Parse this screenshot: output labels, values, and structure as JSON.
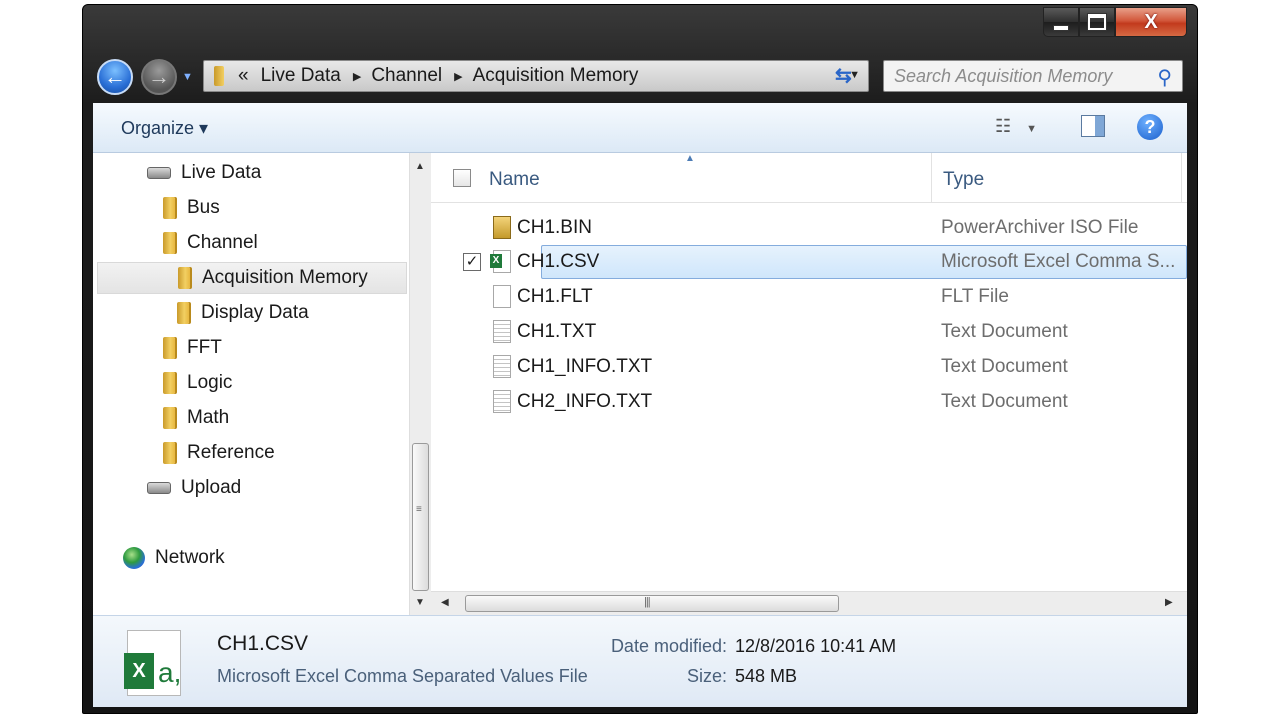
{
  "address": {
    "overflow": "«",
    "crumbs": [
      "Live Data",
      "Channel",
      "Acquisition Memory"
    ]
  },
  "search": {
    "placeholder": "Search Acquisition Memory"
  },
  "toolbar": {
    "organize_label": "Organize ▾"
  },
  "tree": [
    {
      "label": "Live Data",
      "icon": "drive-icon"
    },
    {
      "label": "Bus",
      "icon": "folder-icon"
    },
    {
      "label": "Channel",
      "icon": "folder-icon"
    },
    {
      "label": "Acquisition Memory",
      "icon": "folder-icon",
      "selected": true
    },
    {
      "label": "Display Data",
      "icon": "folder-icon"
    },
    {
      "label": "FFT",
      "icon": "folder-icon"
    },
    {
      "label": "Logic",
      "icon": "folder-icon"
    },
    {
      "label": "Math",
      "icon": "folder-icon"
    },
    {
      "label": "Reference",
      "icon": "folder-icon"
    },
    {
      "label": "Upload",
      "icon": "drive-icon"
    },
    {
      "label": "Network",
      "icon": "globe-icon"
    }
  ],
  "columns": {
    "name": "Name",
    "type": "Type"
  },
  "files": [
    {
      "name": "CH1.BIN",
      "type": "PowerArchiver ISO File",
      "icon": "iso-file-icon"
    },
    {
      "name": "CH1.CSV",
      "type": "Microsoft Excel Comma S...",
      "icon": "excel-file-icon",
      "selected": true
    },
    {
      "name": "CH1.FLT",
      "type": "FLT File",
      "icon": "blank-file-icon"
    },
    {
      "name": "CH1.TXT",
      "type": "Text Document",
      "icon": "text-file-icon"
    },
    {
      "name": "CH1_INFO.TXT",
      "type": "Text Document",
      "icon": "text-file-icon"
    },
    {
      "name": "CH2_INFO.TXT",
      "type": "Text Document",
      "icon": "text-file-icon"
    }
  ],
  "details": {
    "name": "CH1.CSV",
    "type": "Microsoft Excel Comma Separated Values File",
    "date_label": "Date modified:",
    "date_value": "12/8/2016 10:41 AM",
    "size_label": "Size:",
    "size_value": "548 MB"
  },
  "colors": {
    "selection_fill": "#cfe6fb",
    "selection_border": "#84acdd",
    "link_blue": "#2a66c8"
  }
}
